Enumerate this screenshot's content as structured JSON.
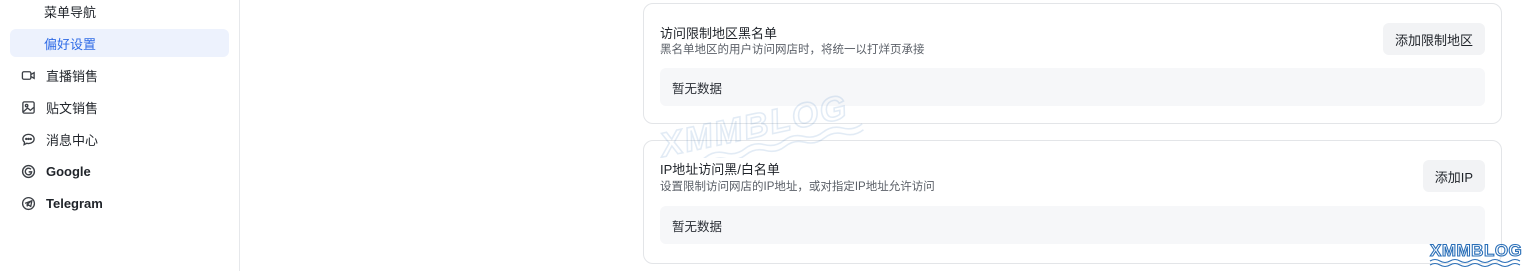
{
  "sidebar": {
    "items": [
      {
        "label": "菜单导航",
        "icon": "",
        "active": false
      },
      {
        "label": "偏好设置",
        "icon": "",
        "active": true
      },
      {
        "label": "直播销售",
        "icon": "video-camera-icon"
      },
      {
        "label": "贴文销售",
        "icon": "image-post-icon"
      },
      {
        "label": "消息中心",
        "icon": "chat-bubble-icon"
      },
      {
        "label": "Google",
        "icon": "google-icon"
      },
      {
        "label": "Telegram",
        "icon": "telegram-icon"
      }
    ]
  },
  "cards": [
    {
      "title": "访问限制地区黑名单",
      "description": "黑名单地区的用户访问网店时，将统一以打烊页承接",
      "button": "添加限制地区",
      "empty": "暂无数据"
    },
    {
      "title": "IP地址访问黑/白名单",
      "description": "设置限制访问网店的IP地址，或对指定IP地址允许访问",
      "button": "添加IP",
      "empty": "暂无数据"
    }
  ],
  "watermark": {
    "text": "XMMBLOG"
  },
  "colors": {
    "accent": "#2f6be6",
    "active_bg": "#edf2fd",
    "watermark": "#2a6fb8"
  }
}
